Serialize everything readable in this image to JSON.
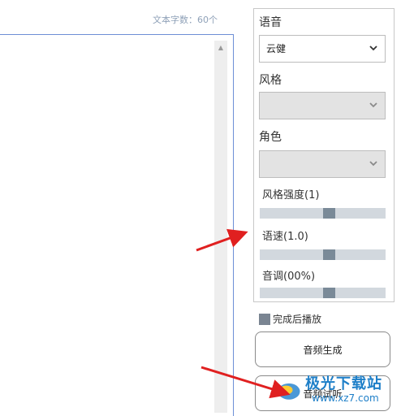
{
  "editor": {
    "char_count": "文本字数：60个"
  },
  "settings": {
    "voice": {
      "label": "语音",
      "value": "云健"
    },
    "style": {
      "label": "风格",
      "value": ""
    },
    "role": {
      "label": "角色",
      "value": ""
    },
    "style_strength": {
      "label": "风格强度(1)",
      "level": 0.55
    },
    "speed": {
      "label": "语速(1.0)",
      "level": 0.55
    },
    "pitch": {
      "label": "音调(00%)",
      "level": 0.55
    }
  },
  "autoplay": {
    "label": "完成后播放",
    "checked": true
  },
  "buttons": {
    "generate": "音频生成",
    "preview": "音频试听"
  },
  "watermark": {
    "brand": "极光下载站",
    "url": "www.xz7.com"
  },
  "colors": {
    "annotation_arrow": "#e02020",
    "slider_thumb": "#7a8a98",
    "editor_border": "#6d8fd6"
  }
}
